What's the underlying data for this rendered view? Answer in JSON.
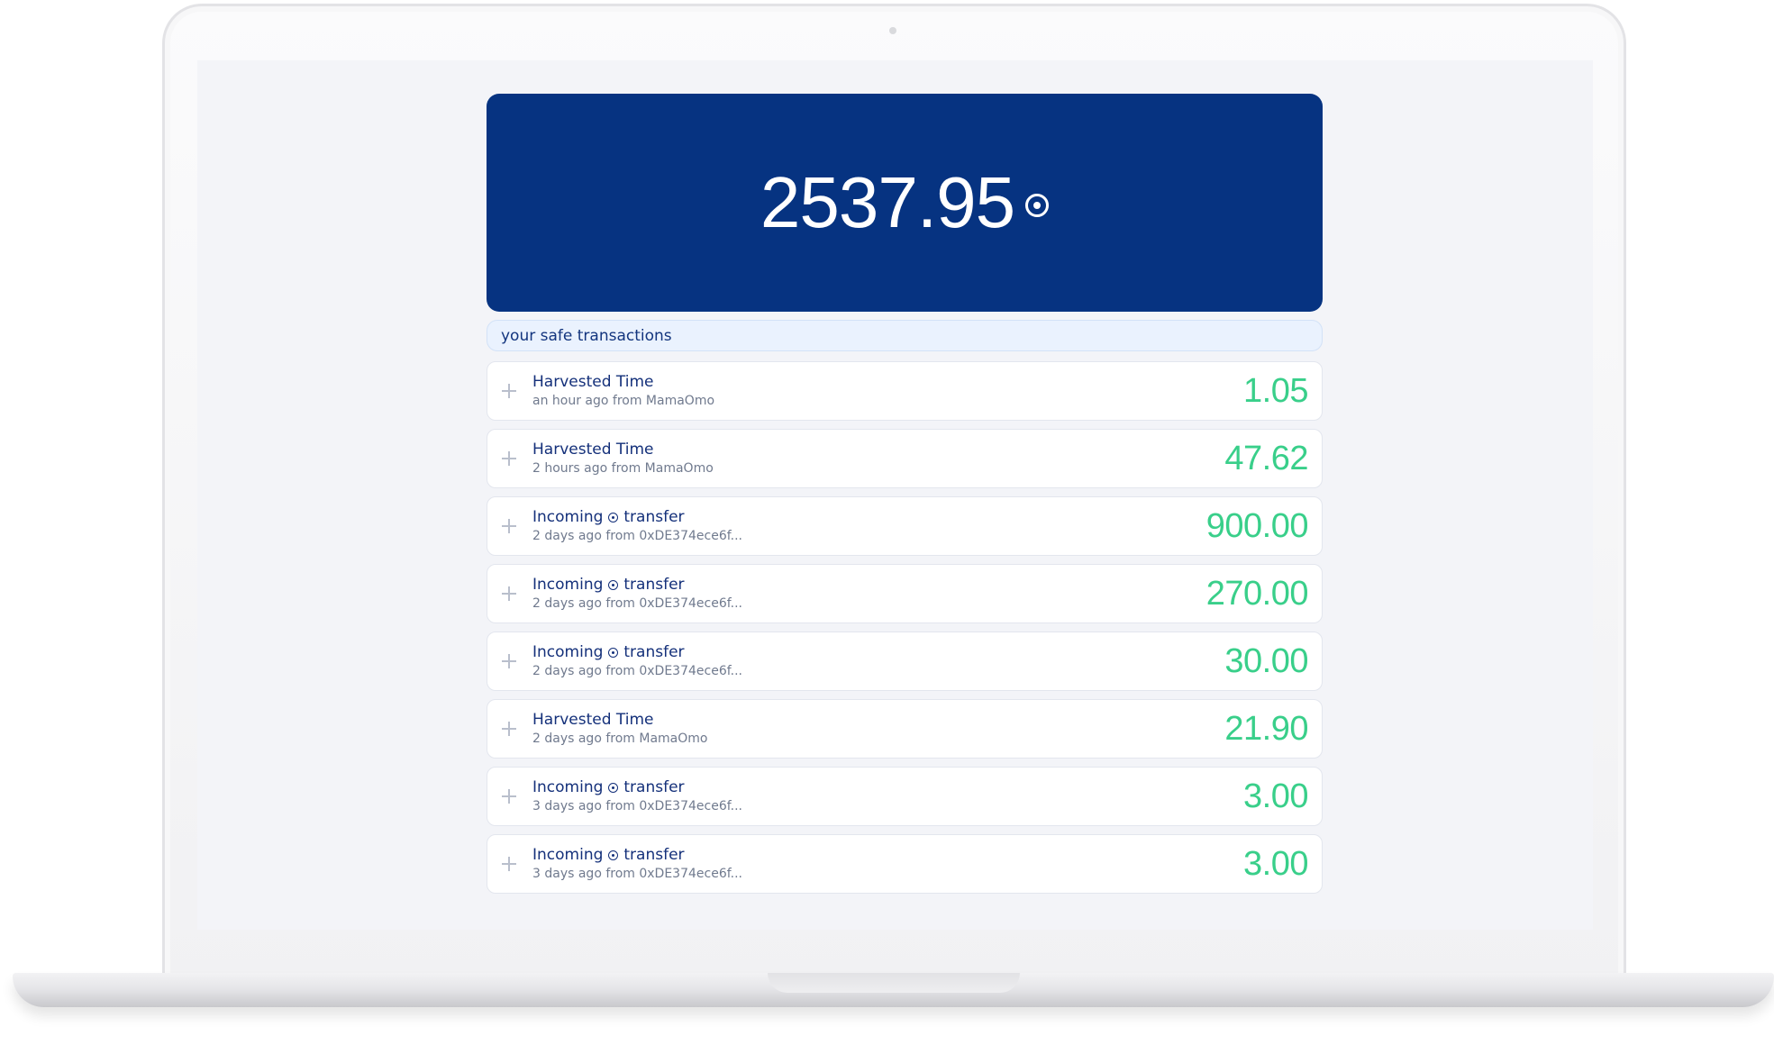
{
  "balance": {
    "amount": "2537.95",
    "token_icon": "token-circle-icon"
  },
  "section": {
    "title": "your safe transactions"
  },
  "transactions": [
    {
      "title": "Harvested Time",
      "has_token_icon": false,
      "title_suffix": "",
      "subtitle": "an hour ago from MamaOmo",
      "amount": "1.05"
    },
    {
      "title": "Harvested Time",
      "has_token_icon": false,
      "title_suffix": "",
      "subtitle": "2 hours ago from MamaOmo",
      "amount": "47.62"
    },
    {
      "title": "Incoming",
      "has_token_icon": true,
      "title_suffix": "transfer",
      "subtitle": "2 days ago from 0xDE374ece6f...",
      "amount": "900.00"
    },
    {
      "title": "Incoming",
      "has_token_icon": true,
      "title_suffix": "transfer",
      "subtitle": "2 days ago from 0xDE374ece6f...",
      "amount": "270.00"
    },
    {
      "title": "Incoming",
      "has_token_icon": true,
      "title_suffix": "transfer",
      "subtitle": "2 days ago from 0xDE374ece6f...",
      "amount": "30.00"
    },
    {
      "title": "Harvested Time",
      "has_token_icon": false,
      "title_suffix": "",
      "subtitle": "2 days ago from MamaOmo",
      "amount": "21.90"
    },
    {
      "title": "Incoming",
      "has_token_icon": true,
      "title_suffix": "transfer",
      "subtitle": "3 days ago from 0xDE374ece6f...",
      "amount": "3.00"
    },
    {
      "title": "Incoming",
      "has_token_icon": true,
      "title_suffix": "transfer",
      "subtitle": "3 days ago from 0xDE374ece6f...",
      "amount": "3.00"
    }
  ],
  "colors": {
    "balance_card": "#063381",
    "amount_positive": "#39cf8a",
    "title_text": "#14307a",
    "subtitle_text": "#707a8e",
    "screen_background": "#f3f4f8"
  }
}
